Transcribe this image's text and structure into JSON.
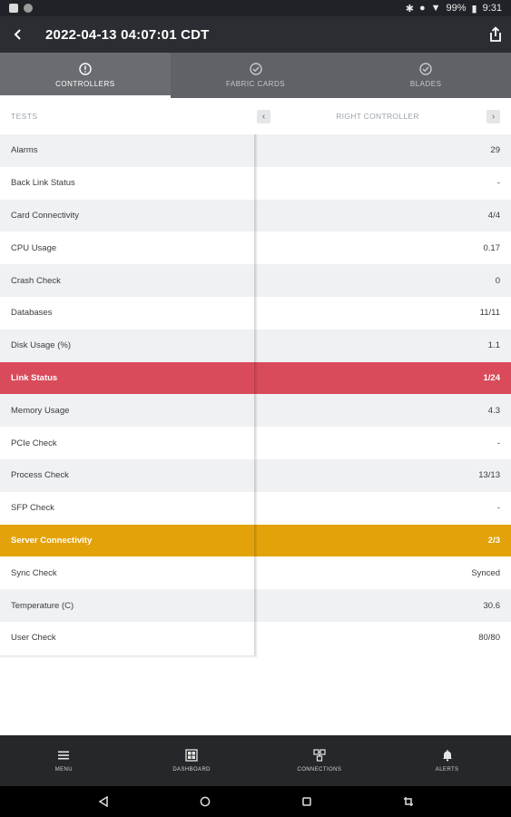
{
  "status_bar": {
    "battery": "99%",
    "time": "9:31"
  },
  "app_bar": {
    "title": "2022-04-13 04:07:01 CDT"
  },
  "tabs": [
    {
      "label": "CONTROLLERS",
      "icon": "info-circle-icon"
    },
    {
      "label": "FABRIC CARDS",
      "icon": "check-circle-icon"
    },
    {
      "label": "BLADES",
      "icon": "check-circle-icon"
    }
  ],
  "table": {
    "tests_header": "TESTS",
    "column_header": "RIGHT CONTROLLER",
    "rows": [
      {
        "test": "Alarms",
        "value": "29"
      },
      {
        "test": "Back Link Status",
        "value": "-"
      },
      {
        "test": "Card Connectivity",
        "value": "4/4"
      },
      {
        "test": "CPU Usage",
        "value": "0.17"
      },
      {
        "test": "Crash Check",
        "value": "0"
      },
      {
        "test": "Databases",
        "value": "11/11"
      },
      {
        "test": "Disk Usage (%)",
        "value": "1.1"
      },
      {
        "test": "Link Status",
        "value": "1/24",
        "status": "error"
      },
      {
        "test": "Memory Usage",
        "value": "4.3"
      },
      {
        "test": "PCIe Check",
        "value": "-"
      },
      {
        "test": "Process Check",
        "value": "13/13"
      },
      {
        "test": "SFP Check",
        "value": "-"
      },
      {
        "test": "Server Connectivity",
        "value": "2/3",
        "status": "warning"
      },
      {
        "test": "Sync Check",
        "value": "Synced"
      },
      {
        "test": "Temperature (C)",
        "value": "30.6"
      },
      {
        "test": "User Check",
        "value": "80/80"
      }
    ]
  },
  "bottom_nav": [
    {
      "label": "MENU",
      "icon": "menu-icon"
    },
    {
      "label": "DASHBOARD",
      "icon": "dashboard-icon"
    },
    {
      "label": "CONNECTIONS",
      "icon": "connections-icon"
    },
    {
      "label": "ALERTS",
      "icon": "bell-icon"
    }
  ],
  "colors": {
    "app_bar": "#2a2d31",
    "tabs_bg": "#5f6266",
    "error": "#d94b5b",
    "warning": "#e4a20a",
    "bottom_nav": "#25282b"
  }
}
